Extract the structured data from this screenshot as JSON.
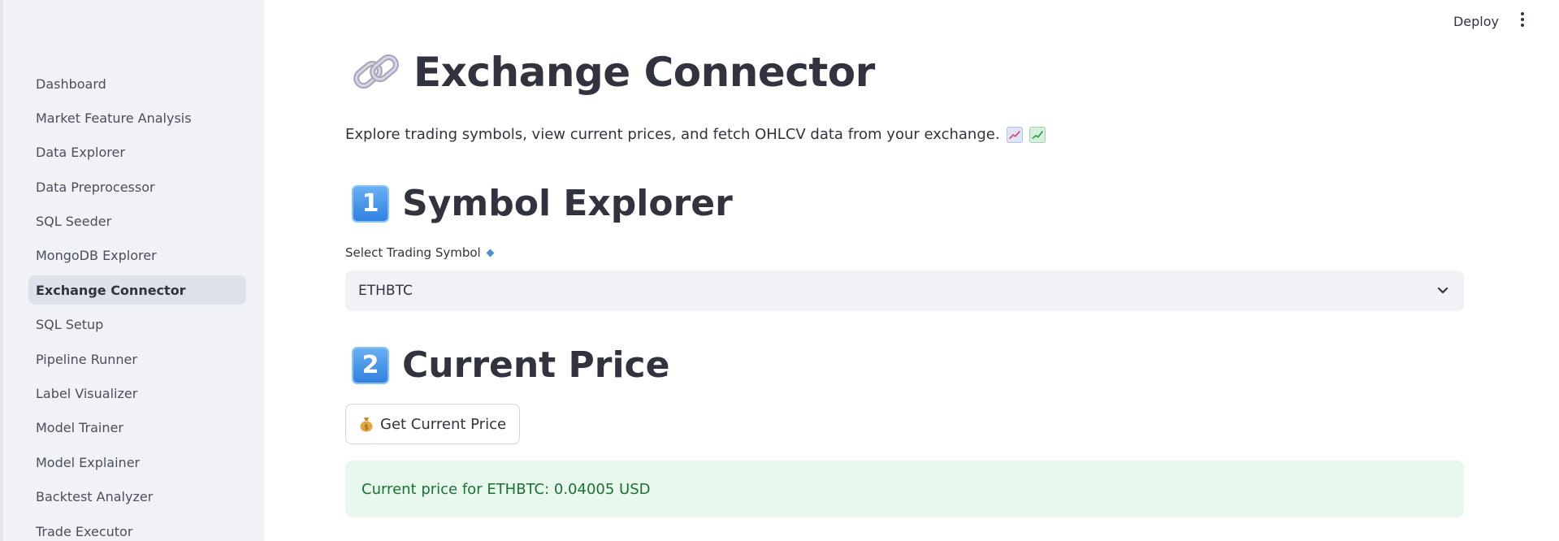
{
  "sidebar": {
    "items": [
      {
        "label": "Dashboard"
      },
      {
        "label": "Market Feature Analysis"
      },
      {
        "label": "Data Explorer"
      },
      {
        "label": "Data Preprocessor"
      },
      {
        "label": "SQL Seeder"
      },
      {
        "label": "MongoDB Explorer"
      },
      {
        "label": "Exchange Connector",
        "active": true
      },
      {
        "label": "SQL Setup"
      },
      {
        "label": "Pipeline Runner"
      },
      {
        "label": "Label Visualizer"
      },
      {
        "label": "Model Trainer"
      },
      {
        "label": "Model Explainer"
      },
      {
        "label": "Backtest Analyzer"
      },
      {
        "label": "Trade Executor"
      }
    ]
  },
  "header": {
    "deploy_label": "Deploy",
    "menu_icon": "kebab-menu-icon"
  },
  "main": {
    "title": "Exchange Connector",
    "title_icon": "link-icon",
    "subtitle": "Explore trading symbols, view current prices, and fetch OHLCV data from your exchange.",
    "subtitle_icons": [
      "chart-increasing-icon",
      "chart-green-icon"
    ],
    "symbol_section": {
      "number": "1",
      "title": "Symbol Explorer",
      "select_label": "Select Trading Symbol",
      "select_value": "ETHBTC"
    },
    "price_section": {
      "number": "2",
      "title": "Current Price",
      "button_label": "Get Current Price",
      "button_icon": "money-bag-icon",
      "result_text": "Current price for ETHBTC: 0.04005 USD"
    }
  },
  "colors": {
    "sidebar_bg": "#f0f2f6",
    "active_item_bg": "#dde1e9",
    "text": "#31333f",
    "success_bg": "#e8f8ec",
    "success_text": "#177233",
    "badge_blue": "#2d7ee0"
  }
}
